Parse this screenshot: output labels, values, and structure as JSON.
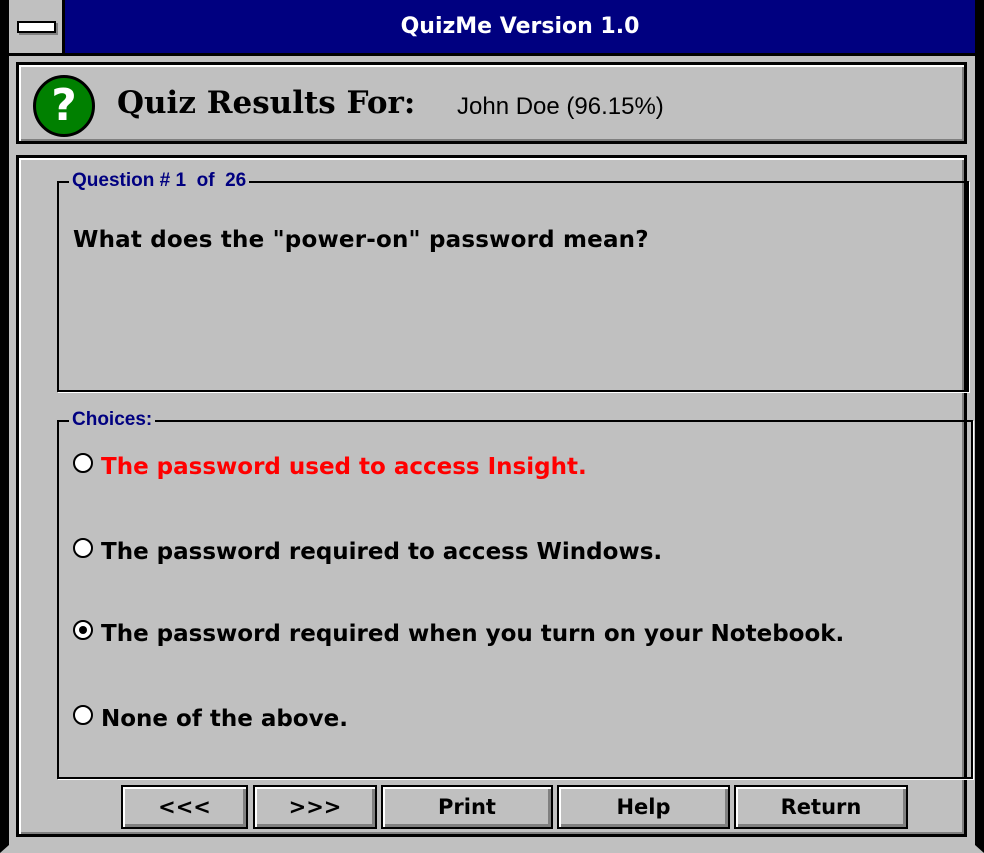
{
  "window": {
    "title": "QuizMe Version 1.0"
  },
  "header": {
    "icon": "question-mark-icon",
    "icon_glyph": "?",
    "label": "Quiz Results For:",
    "value": "John Doe (96.15%)"
  },
  "question_group": {
    "legend": "Question # 1  of  26",
    "text": "What does the \"power-on\" password mean?"
  },
  "choices_group": {
    "legend": "Choices:",
    "items": [
      {
        "label": "The password used to access Insight.",
        "selected": false,
        "status": "incorrect"
      },
      {
        "label": "The password required to access Windows.",
        "selected": false,
        "status": "normal"
      },
      {
        "label": "The password required when you turn on your Notebook.",
        "selected": true,
        "status": "normal"
      },
      {
        "label": "None of the above.",
        "selected": false,
        "status": "normal"
      }
    ]
  },
  "buttons": {
    "prev": "<<<",
    "next": ">>>",
    "print": "Print",
    "help": "Help",
    "return": "Return"
  },
  "colors": {
    "window_bg": "#c0c0c0",
    "title_bar": "#000080",
    "legend_text": "#000080",
    "incorrect_answer": "#ff0000",
    "icon_green": "#008000"
  }
}
